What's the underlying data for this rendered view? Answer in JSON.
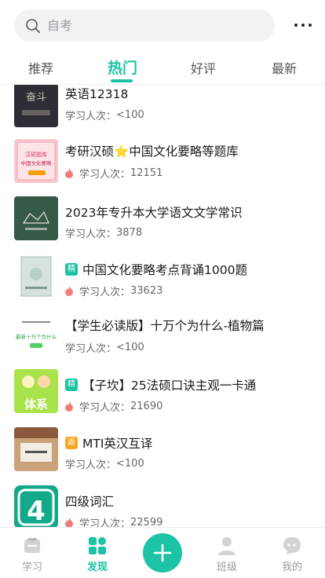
{
  "search": {
    "placeholder": "自考"
  },
  "tabs": [
    {
      "label": "推荐"
    },
    {
      "label": "热门"
    },
    {
      "label": "好评"
    },
    {
      "label": "最新"
    }
  ],
  "active_tab": "热门",
  "list": [
    {
      "title": "英语12318",
      "meta_label": "学习人次：",
      "count": "<100",
      "badge": "",
      "hot": false,
      "thumb_text": "奋斗"
    },
    {
      "title": "考研汉硕⭐中国文化要略等题库",
      "meta_label": "学习人次：",
      "count": "12151",
      "badge": "",
      "hot": true,
      "thumb_text": "中国文化要略"
    },
    {
      "title": "2023年专升本大学语文文学常识",
      "meta_label": "学习人次：",
      "count": "3878",
      "badge": "",
      "hot": false,
      "thumb_text": ""
    },
    {
      "title": "中国文化要略考点背诵1000题",
      "meta_label": "学习人次：",
      "count": "33623",
      "badge": "精",
      "hot": true,
      "thumb_text": ""
    },
    {
      "title": "【学生必读版】十万个为什么-植物篇",
      "meta_label": "学习人次：",
      "count": "<100",
      "badge": "",
      "hot": false,
      "thumb_text": "最新十万个为什么"
    },
    {
      "title": "【子坎】25法硕口诀主观一卡通",
      "meta_label": "学习人次：",
      "count": "21690",
      "badge": "精",
      "hot": true,
      "thumb_text": "体系"
    },
    {
      "title": "MTI英汉互译",
      "meta_label": "学习人次：",
      "count": "<100",
      "badge": "返",
      "hot": false,
      "thumb_text": ""
    },
    {
      "title": "四级词汇",
      "meta_label": "学习人次：",
      "count": "22599",
      "badge": "",
      "hot": true,
      "thumb_text": "4"
    }
  ],
  "bottom_nav": [
    {
      "label": "学习",
      "icon": "book-icon"
    },
    {
      "label": "发现",
      "icon": "discover-icon"
    },
    {
      "label": "",
      "icon": "plus-icon"
    },
    {
      "label": "班级",
      "icon": "class-icon"
    },
    {
      "label": "我的",
      "icon": "profile-icon"
    }
  ],
  "colors": {
    "accent": "#1cc3a4",
    "badge_orange": "#f5a623",
    "flame": "#f17a7a"
  }
}
